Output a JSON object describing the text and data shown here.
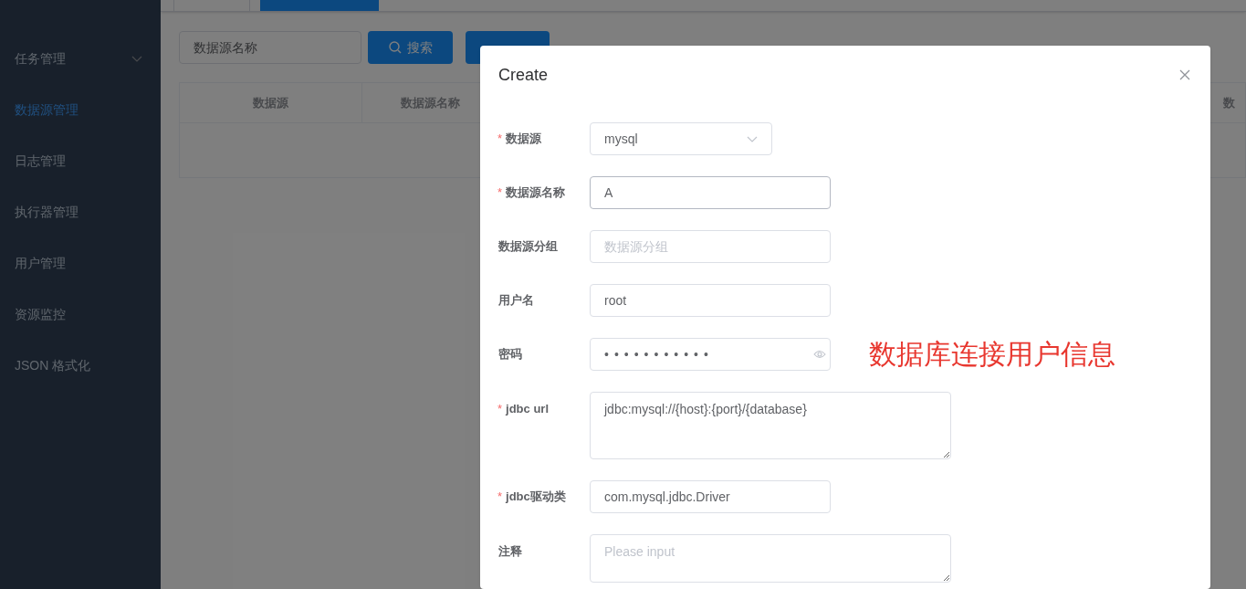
{
  "sidebar": {
    "items": [
      {
        "label": "任务管理",
        "selected": false,
        "expandable": true
      },
      {
        "label": "数据源管理",
        "selected": true,
        "expandable": false
      },
      {
        "label": "日志管理",
        "selected": false,
        "expandable": false
      },
      {
        "label": "执行器管理",
        "selected": false,
        "expandable": false
      },
      {
        "label": "用户管理",
        "selected": false,
        "expandable": false
      },
      {
        "label": "资源监控",
        "selected": false,
        "expandable": false
      },
      {
        "label": "JSON 格式化",
        "selected": false,
        "expandable": false
      }
    ]
  },
  "tabs": [
    {
      "selected": false
    },
    {
      "selected": true
    }
  ],
  "toolbar": {
    "search": {
      "placeholder": "数据源名称"
    },
    "search_button": "搜索"
  },
  "table": {
    "columns": [
      "数据源",
      "数据源名称",
      "数"
    ]
  },
  "dialog": {
    "title": "Create",
    "fields": [
      {
        "label": "数据源",
        "required_mark": "*",
        "kind": "select",
        "value": "mysql"
      },
      {
        "label": "数据源名称",
        "required_mark": "*",
        "kind": "text",
        "value": "A"
      },
      {
        "label": "数据源分组",
        "kind": "text",
        "placeholder": "数据源分组"
      },
      {
        "label": "用户名",
        "kind": "text",
        "value": "root"
      },
      {
        "label": "密码",
        "kind": "password",
        "value": "•••••••••••",
        "annotation": "数据库连接用户信息"
      },
      {
        "label": "jdbc url",
        "required_mark": "*",
        "kind": "textarea",
        "value": "jdbc:mysql://{host}:{port}/{database}"
      },
      {
        "label": "jdbc驱动类",
        "required_mark": "*",
        "kind": "text",
        "value": "com.mysql.jdbc.Driver"
      },
      {
        "label": "注释",
        "kind": "memo",
        "placeholder": "Please input"
      }
    ]
  }
}
